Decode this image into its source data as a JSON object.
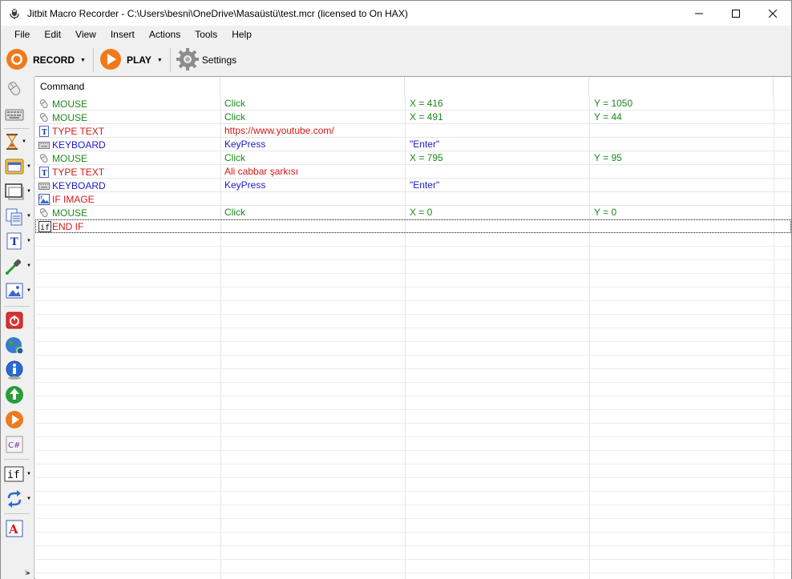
{
  "window": {
    "title": "Jitbit Macro Recorder - C:\\Users\\besni\\OneDrive\\Masaüstü\\test.mcr (licensed to On HAX)"
  },
  "menu": [
    "File",
    "Edit",
    "View",
    "Insert",
    "Actions",
    "Tools",
    "Help"
  ],
  "toolbar": {
    "record_label": "RECORD",
    "play_label": "PLAY",
    "settings_label": "Settings"
  },
  "sidebar": {
    "icons": [
      "mouse-icon",
      "keyboard-icon",
      "hourglass-icon",
      "window-icon",
      "window-frame-icon",
      "copy-icon",
      "text-icon",
      "dropper-icon",
      "image-icon",
      "stop-icon",
      "globe-icon",
      "info-icon",
      "recycle-icon",
      "play-circle-icon",
      "csharp-icon",
      "if-icon",
      "loop-icon",
      "font-icon"
    ]
  },
  "grid": {
    "column_header": "Command",
    "rows": [
      {
        "icon": "mouse-icon",
        "command": "MOUSE",
        "p1": "Click",
        "p2": "X = 416",
        "p3": "Y = 1050",
        "color": "green"
      },
      {
        "icon": "mouse-icon",
        "command": "MOUSE",
        "p1": "Click",
        "p2": "X = 491",
        "p3": "Y = 44",
        "color": "green"
      },
      {
        "icon": "text-icon",
        "command": "TYPE TEXT",
        "p1": "https://www.youtube.com/",
        "p2": "",
        "p3": "",
        "color": "red"
      },
      {
        "icon": "keyboard-icon",
        "command": "KEYBOARD",
        "p1": "KeyPress",
        "p2": "\"Enter\"",
        "p3": "",
        "color": "blue"
      },
      {
        "icon": "mouse-icon",
        "command": "MOUSE",
        "p1": "Click",
        "p2": "X = 795",
        "p3": "Y = 95",
        "color": "green"
      },
      {
        "icon": "text-icon",
        "command": "TYPE TEXT",
        "p1": "Ali cabbar şarkısı",
        "p2": "",
        "p3": "",
        "color": "red"
      },
      {
        "icon": "keyboard-icon",
        "command": "KEYBOARD",
        "p1": "KeyPress",
        "p2": "\"Enter\"",
        "p3": "",
        "color": "blue"
      },
      {
        "icon": "image-icon",
        "command": "IF IMAGE",
        "p1": "",
        "p2": "",
        "p3": "",
        "color": "red"
      },
      {
        "icon": "mouse-icon",
        "command": "MOUSE",
        "p1": "Click",
        "p2": "X = 0",
        "p3": "Y = 0",
        "color": "green"
      },
      {
        "icon": "if-icon",
        "command": "END IF",
        "p1": "",
        "p2": "",
        "p3": "",
        "color": "red"
      }
    ]
  }
}
